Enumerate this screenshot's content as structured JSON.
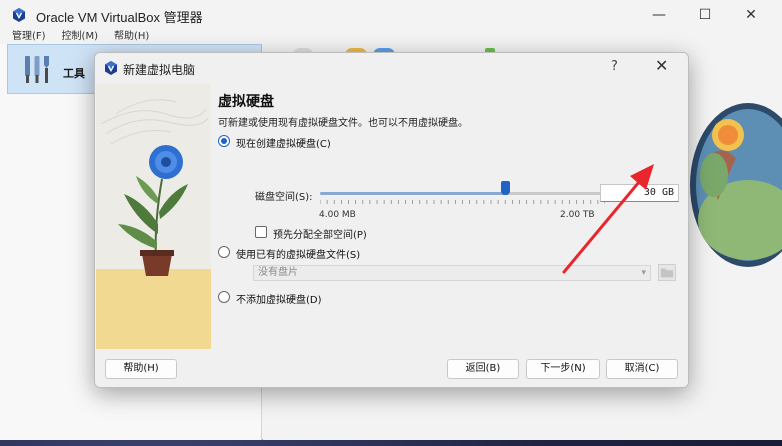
{
  "app": {
    "title": "Oracle VM VirtualBox 管理器",
    "window_controls": {
      "minimize": "—",
      "maximize": "☐",
      "close": "✕"
    }
  },
  "menubar": {
    "items": [
      {
        "label": "管理(F)"
      },
      {
        "label": "控制(M)"
      },
      {
        "label": "帮助(H)"
      }
    ]
  },
  "sidebar": {
    "tools_label": "工具"
  },
  "dialog": {
    "title": "新建虚拟电脑",
    "help": "?",
    "close": "✕",
    "page_title": "虚拟硬盘",
    "description": "可新建或使用现有虚拟硬盘文件。也可以不用虚拟硬盘。",
    "option_create": {
      "label": "现在创建虚拟硬盘(C)",
      "checked": true
    },
    "disk_size": {
      "label": "磁盘空间(S):",
      "value": "30 GB",
      "min_label": "4.00 MB",
      "max_label": "2.00 TB",
      "slider_fraction": 0.65
    },
    "preallocate": {
      "label": "预先分配全部空间(P)",
      "checked": false
    },
    "option_existing": {
      "label": "使用已有的虚拟硬盘文件(S)",
      "checked": false,
      "placeholder": "没有盘片"
    },
    "option_none": {
      "label": "不添加虚拟硬盘(D)",
      "checked": false
    },
    "buttons": {
      "help": "帮助(H)",
      "back": "返回(B)",
      "next": "下一步(N)",
      "cancel": "取消(C)"
    }
  },
  "colors": {
    "accent": "#1f64c4",
    "selection": "#cfe3f6",
    "annotation_arrow": "#e8262b"
  }
}
